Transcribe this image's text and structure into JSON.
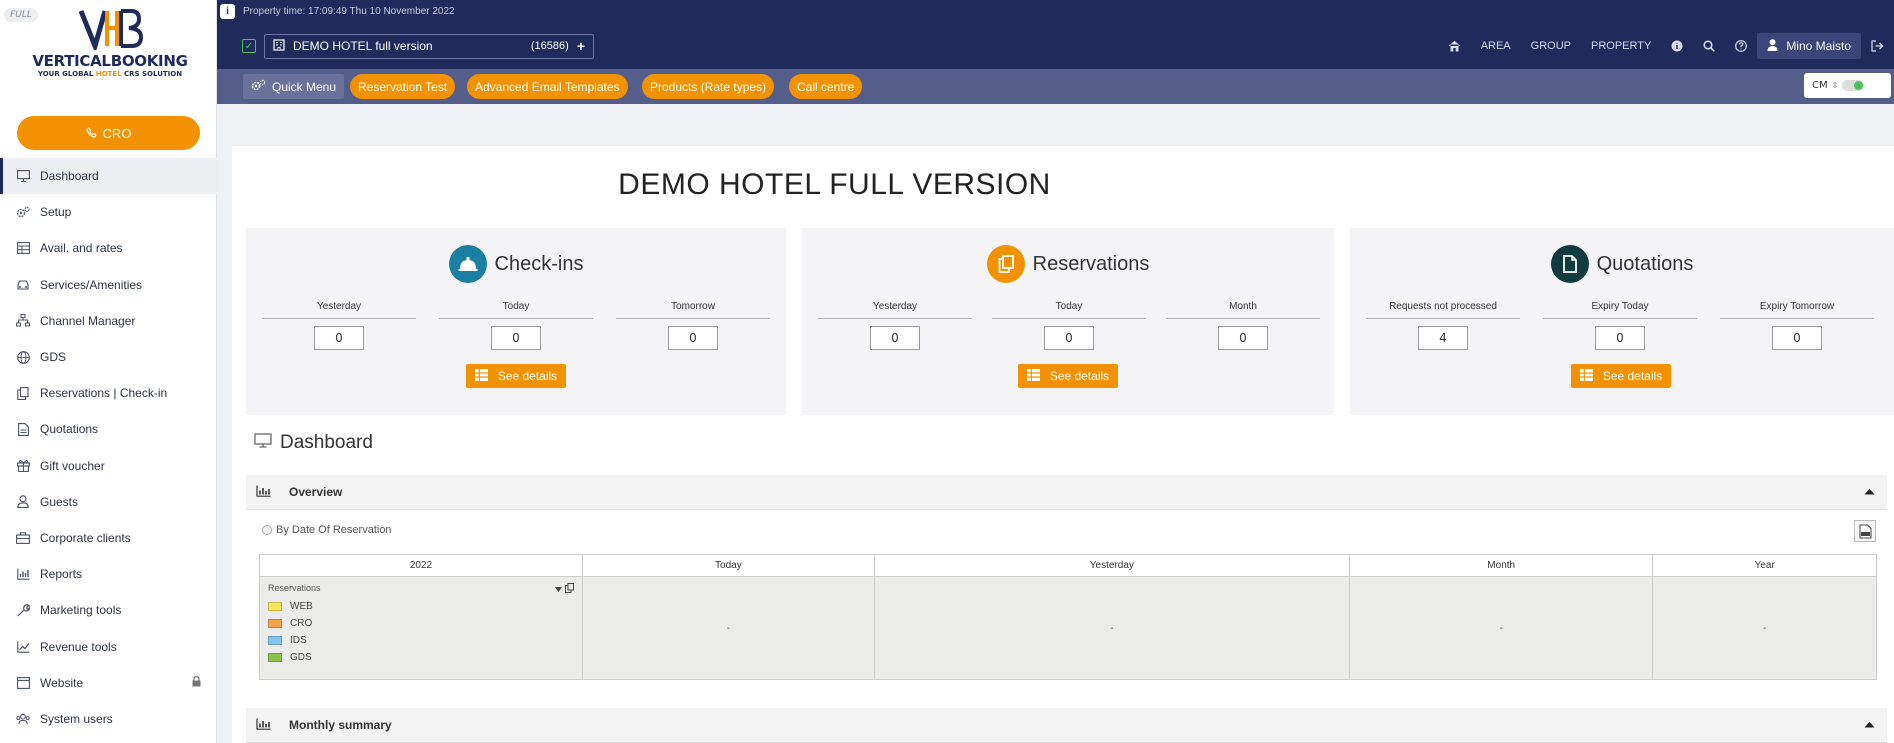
{
  "app": {
    "badge": "FULL",
    "logo_name": "VERTICALBOOKING",
    "logo_tag_pre": "YOUR GLOBAL",
    "logo_tag_mid": "HOTEL",
    "logo_tag_post": "CRS SOLUTION"
  },
  "sidebar": {
    "cro_label": "CRO",
    "items": [
      {
        "label": "Dashboard",
        "icon": "monitor-icon"
      },
      {
        "label": "Setup",
        "icon": "gears-icon"
      },
      {
        "label": "Avail. and rates",
        "icon": "table-icon"
      },
      {
        "label": "Services/Amenities",
        "icon": "car-icon"
      },
      {
        "label": "Channel Manager",
        "icon": "sitemap-icon"
      },
      {
        "label": "GDS",
        "icon": "globe-icon"
      },
      {
        "label": "Reservations | Check-in",
        "icon": "copy-icon"
      },
      {
        "label": "Quotations",
        "icon": "file-icon"
      },
      {
        "label": "Gift voucher",
        "icon": "gift-icon"
      },
      {
        "label": "Guests",
        "icon": "user-icon"
      },
      {
        "label": "Corporate clients",
        "icon": "briefcase-icon"
      },
      {
        "label": "Reports",
        "icon": "bar-chart-icon"
      },
      {
        "label": "Marketing tools",
        "icon": "wrench-icon"
      },
      {
        "label": "Revenue tools",
        "icon": "line-chart-icon"
      },
      {
        "label": "Website",
        "icon": "browser-icon"
      },
      {
        "label": "System users",
        "icon": "users-icon"
      }
    ]
  },
  "header": {
    "property_time": "Property time: 17:09:49 Thu 10 November 2022",
    "hotel_name": "DEMO HOTEL full version",
    "hotel_code": "(16586)",
    "nav": [
      "AREA",
      "GROUP",
      "PROPERTY"
    ],
    "user_name": "Mino Maisto"
  },
  "quickbar": {
    "quick_menu": "Quick Menu",
    "pills": [
      "Reservation Test",
      "Advanced Email Templates",
      "Products (Rate types)",
      "Call centre"
    ],
    "cm_label": "CM"
  },
  "main": {
    "title": "DEMO HOTEL FULL VERSION",
    "see_details": "See details",
    "checkins": {
      "title": "Check-ins",
      "labels": [
        "Yesterday",
        "Today",
        "Tomorrow"
      ],
      "values": [
        "0",
        "0",
        "0"
      ]
    },
    "reservations": {
      "title": "Reservations",
      "labels": [
        "Yesterday",
        "Today",
        "Month"
      ],
      "values": [
        "0",
        "0",
        "0"
      ]
    },
    "quotations": {
      "title": "Quotations",
      "labels": [
        "Requests not processed",
        "Expiry Today",
        "Expiry Tomorrow"
      ],
      "values": [
        "4",
        "0",
        "0"
      ]
    },
    "dashboard_title": "Dashboard",
    "overview_title": "Overview",
    "radio_label": "By Date Of Reservation",
    "table": {
      "headers": [
        "2022",
        "Today",
        "Yesterday",
        "Month",
        "Year"
      ],
      "cells": [
        "-",
        "-",
        "-",
        "-"
      ],
      "legend_title": "Reservations",
      "legend": [
        {
          "label": "WEB",
          "color": "#f7e55a"
        },
        {
          "label": "CRO",
          "color": "#f6a14a"
        },
        {
          "label": "IDS",
          "color": "#7fc8ec"
        },
        {
          "label": "GDS",
          "color": "#8bc34a"
        }
      ]
    },
    "monthly_title": "Monthly summary"
  },
  "colors": {
    "brand_navy": "#1f2b5b",
    "accent_orange": "#f39200",
    "checkins_circle": "#1b7fa3",
    "reservations_circle": "#f39200",
    "quotations_circle": "#123b40"
  }
}
